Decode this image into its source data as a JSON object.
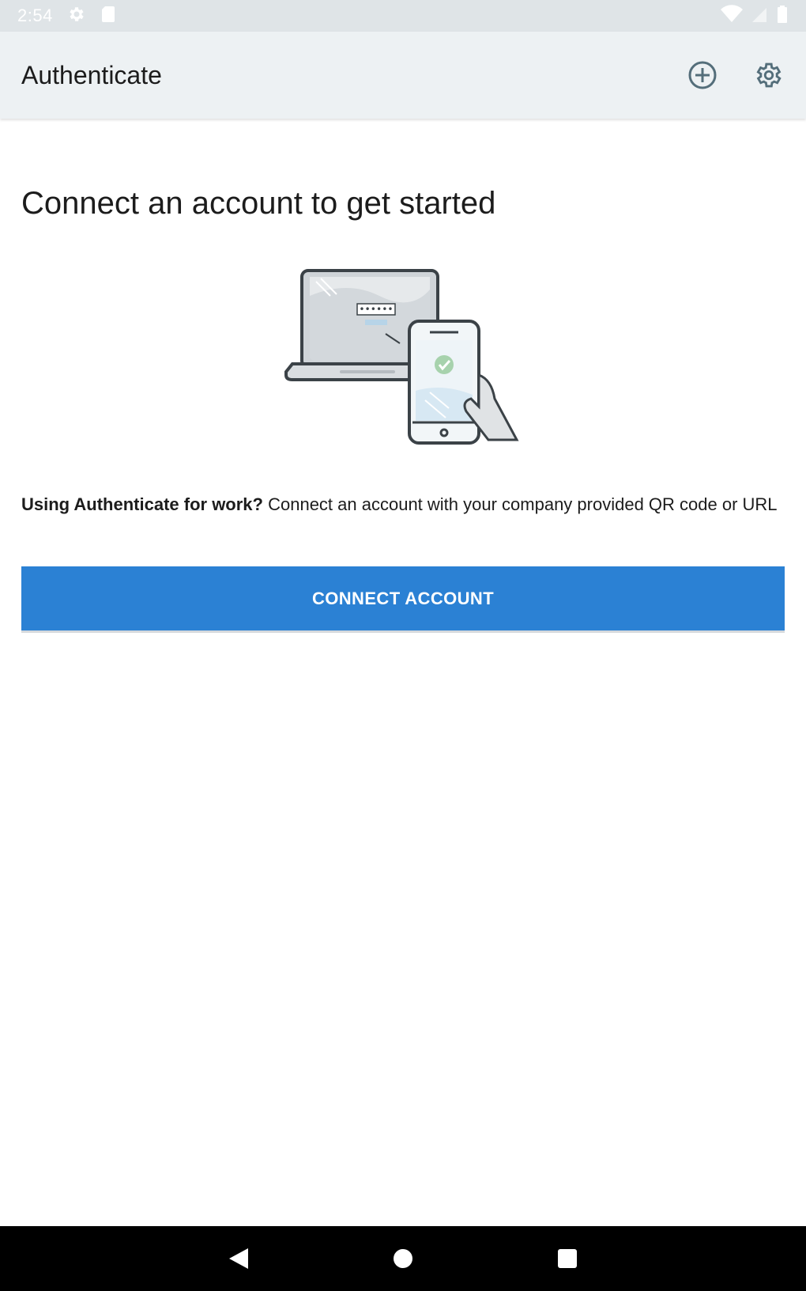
{
  "status_bar": {
    "time": "2:54"
  },
  "app_bar": {
    "title": "Authenticate",
    "actions": [
      {
        "icon": "add-circle-icon",
        "label": "Add"
      },
      {
        "icon": "gear-icon",
        "label": "Settings"
      }
    ]
  },
  "main": {
    "heading": "Connect an account to get started",
    "work_prompt_bold": "Using Authenticate for work?",
    "work_prompt_rest": " Connect an account with your company provided QR code or URL",
    "connect_button_label": "CONNECT ACCOUNT"
  },
  "colors": {
    "accent": "#2b81d4",
    "app_bar": "#edf1f3",
    "status_bar": "#dfe4e7",
    "icon": "#546e7a"
  }
}
